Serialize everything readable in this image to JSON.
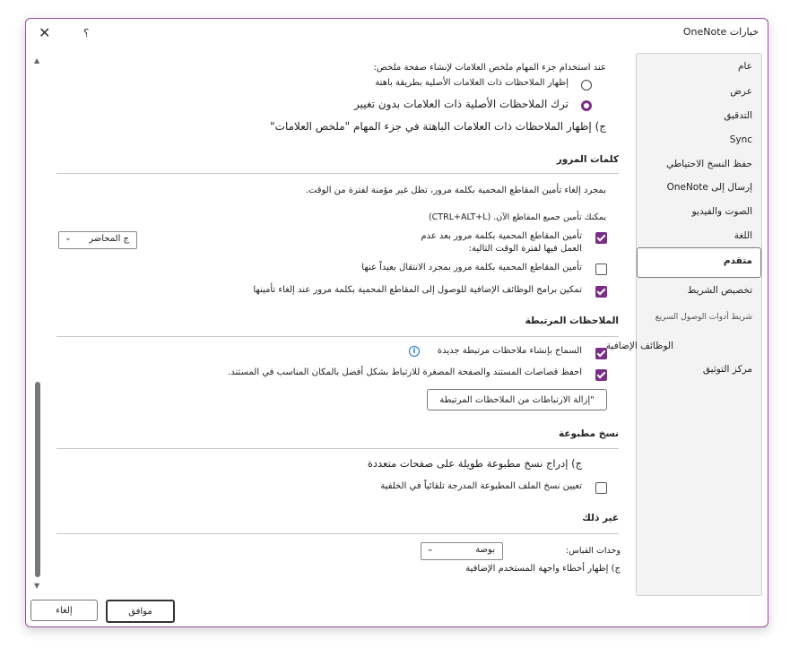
{
  "window": {
    "title": "خيارات OneNote",
    "close_glyph": "✕",
    "help_glyph": "؟"
  },
  "nav": {
    "items": [
      {
        "label": "عام"
      },
      {
        "label": "عرض"
      },
      {
        "label": "التدقيق"
      },
      {
        "label": "Sync"
      },
      {
        "label": "حفظ النسخ الاحتياطي"
      },
      {
        "label": "إرسال إلى OneNote"
      },
      {
        "label": "الصوت والفيديو"
      },
      {
        "label": "اللغة"
      },
      {
        "label": "متقدم"
      },
      {
        "label": "تخصيص الشريط"
      },
      {
        "label": "شريط أدوات الوصول السريع"
      },
      {
        "label": "الوظائف الإضافية"
      },
      {
        "label": "مركز التوثيق"
      }
    ],
    "selected": "متقدم"
  },
  "tags": {
    "intro": "عند استخدام جزء المهام ملخص العلامات لإنشاء صفحة ملخص:",
    "option1": "إظهار الملاحظات ذات العلامات الأصلية بطريقة باهتة",
    "option2": "ترك الملاحظات الأصلية ذات العلامات بدون تغيير",
    "option3": "ج) إظهار الملاحظات ذات العلامات الباهتة في جزء المهام \"ملخص العلامات\""
  },
  "passwords": {
    "header": "كلمات المرور",
    "desc": "بمجرد إلغاء تأمين المقاطع المحمية بكلمة مرور، تظل غير مؤمنة لفترة من الوقت.",
    "hint": "يمكنك تأمين جميع المقاطع الآن. (CTRL+ALT+L)",
    "lock_idle": "تأمين المقاطع المحمية بكلمة مرور بعد عدم العمل فيها لفترة الوقت التالية:",
    "lock_idle_value": "ج المحاضر",
    "lock_away": "تأمين المقاطع المحمية بكلمة مرور بمجرد الانتقال بعيداً عنها",
    "addins_access": "تمكين برامج الوظائف الإضافية للوصول إلى المقاطع المحمية بكلمة مرور عند إلغاء تأمينها"
  },
  "linked": {
    "header": "الملاحظات المرتبطة",
    "allow_new": "السماح بإنشاء ملاحظات مرتبطة جديدة",
    "keep_snippets": "احفظ قصاصات المستند والصفحة المصغرة للارتباط بشكل أفضل بالمكان المناسب في المستند.",
    "remove_links": "إزالة الارتباطات من الملاحظات المرتبطة\""
  },
  "printouts": {
    "header": "نسخ مطبوعة",
    "insert_long": "ج) إدراج نسخ مطبوعة طويلة على صفحات متعددة",
    "bg_insert": "تعيين نسخ الملف المطبوعة المدرجة تلقائياً في الخلفية"
  },
  "other": {
    "header": "غير ذلك",
    "units_label": "وحدات القياس:",
    "units_value": "بوصة",
    "show_errors": "ج) إظهار أخطاء واجهة المستخدم الإضافية"
  },
  "footer": {
    "ok": "موافق",
    "cancel": "إلغاء"
  },
  "states": {
    "option1": false,
    "option2": true,
    "lock_idle": true,
    "lock_away": false,
    "addins_access": true,
    "allow_new": true,
    "keep_snippets": true,
    "bg_insert": false
  },
  "colors": {
    "accent": "#7a2f86",
    "dialog_border": "#9b4aa6"
  }
}
